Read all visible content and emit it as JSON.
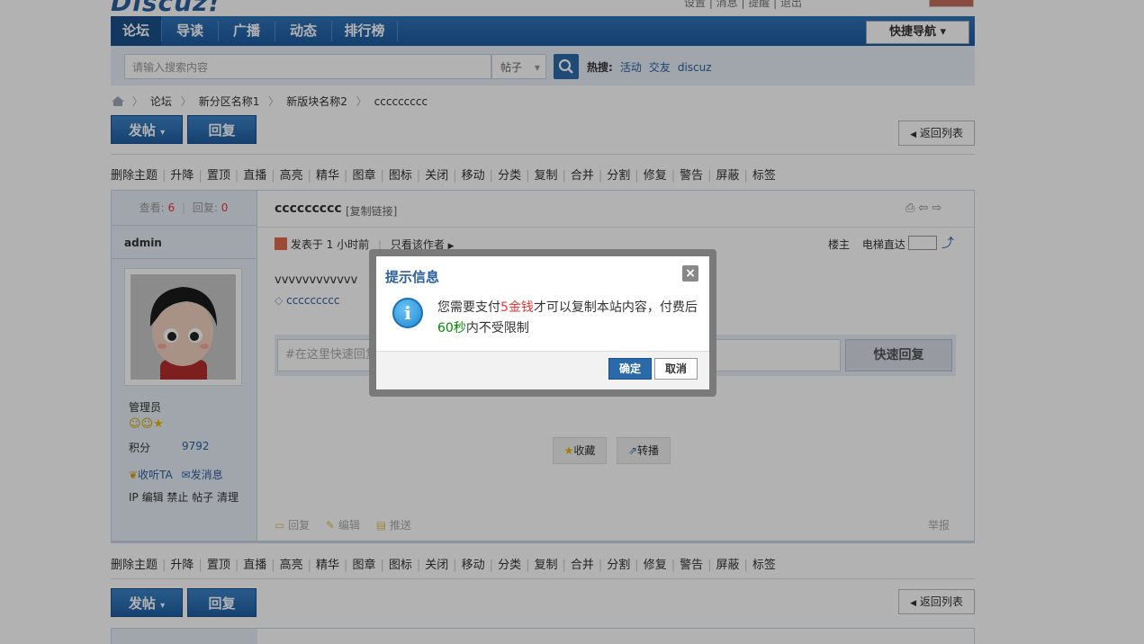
{
  "site": {
    "logo": "Discuz!",
    "user_links": "设置 | 消息 | 提醒 | 退出"
  },
  "nav": {
    "items": [
      "论坛",
      "导读",
      "广播",
      "动态",
      "排行榜"
    ],
    "quicknav_label": "快捷导航"
  },
  "search": {
    "placeholder": "请输入搜索内容",
    "type_label": "帖子",
    "hot_label": "热搜:",
    "hot_terms": [
      "活动",
      "交友",
      "discuz"
    ]
  },
  "breadcrumb": [
    "论坛",
    "新分区名称1",
    "新版块名称2",
    "ccccccccc"
  ],
  "actions": {
    "post_label": "发帖",
    "reply_label": "回复",
    "back_label": "返回列表"
  },
  "modbar": [
    "删除主题",
    "升降",
    "置顶",
    "直播",
    "高亮",
    "精华",
    "图章",
    "图标",
    "关闭",
    "移动",
    "分类",
    "复制",
    "合并",
    "分割",
    "修复",
    "警告",
    "屏蔽",
    "标签"
  ],
  "thread": {
    "views_label": "查看:",
    "views": "6",
    "replies_label": "回复:",
    "replies": "0",
    "title": "ccccccccc",
    "copy_link": "[复制链接]",
    "author": "admin",
    "posted_label": "发表于",
    "posted_time": "1 小时前",
    "only_author": "只看该作者",
    "floor_label": "楼主",
    "elevator_label": "电梯直达",
    "content": "vvvvvvvvvvvv",
    "tag": "ccccccccc",
    "quick_reply_placeholder": "#在这里快速回复#",
    "quick_reply_btn": "快速回复",
    "fav_label": "收藏",
    "share_label": "转播",
    "reply_link": "回复",
    "edit_link": "编辑",
    "push_link": "推送",
    "report_link": "举报"
  },
  "profile": {
    "group": "管理员",
    "credits_label": "积分",
    "credits": "9792",
    "follow": "收听TA",
    "message": "发消息",
    "admin_links": "IP 编辑 禁止 帖子 清理"
  },
  "dialog": {
    "title": "提示信息",
    "msg_pre": "您需要支付",
    "msg_cost": "5金钱",
    "msg_mid": "才可以复制本站内容，付费后",
    "msg_time": "60秒",
    "msg_post": "内不受限制",
    "ok_label": "确定",
    "cancel_label": "取消"
  },
  "colors": {
    "accent": "#2b6aa8",
    "nav": "#1c5ba0",
    "panel": "#e7eef6",
    "cost": "#e33",
    "time": "#080"
  }
}
